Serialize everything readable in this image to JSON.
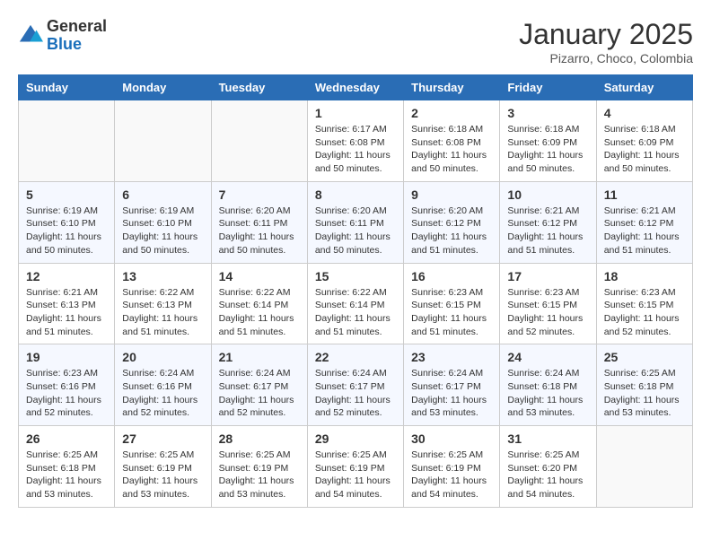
{
  "header": {
    "logo_general": "General",
    "logo_blue": "Blue",
    "month_title": "January 2025",
    "subtitle": "Pizarro, Choco, Colombia"
  },
  "days_of_week": [
    "Sunday",
    "Monday",
    "Tuesday",
    "Wednesday",
    "Thursday",
    "Friday",
    "Saturday"
  ],
  "weeks": [
    [
      {
        "day": "",
        "info": ""
      },
      {
        "day": "",
        "info": ""
      },
      {
        "day": "",
        "info": ""
      },
      {
        "day": "1",
        "info": "Sunrise: 6:17 AM\nSunset: 6:08 PM\nDaylight: 11 hours\nand 50 minutes."
      },
      {
        "day": "2",
        "info": "Sunrise: 6:18 AM\nSunset: 6:08 PM\nDaylight: 11 hours\nand 50 minutes."
      },
      {
        "day": "3",
        "info": "Sunrise: 6:18 AM\nSunset: 6:09 PM\nDaylight: 11 hours\nand 50 minutes."
      },
      {
        "day": "4",
        "info": "Sunrise: 6:18 AM\nSunset: 6:09 PM\nDaylight: 11 hours\nand 50 minutes."
      }
    ],
    [
      {
        "day": "5",
        "info": "Sunrise: 6:19 AM\nSunset: 6:10 PM\nDaylight: 11 hours\nand 50 minutes."
      },
      {
        "day": "6",
        "info": "Sunrise: 6:19 AM\nSunset: 6:10 PM\nDaylight: 11 hours\nand 50 minutes."
      },
      {
        "day": "7",
        "info": "Sunrise: 6:20 AM\nSunset: 6:11 PM\nDaylight: 11 hours\nand 50 minutes."
      },
      {
        "day": "8",
        "info": "Sunrise: 6:20 AM\nSunset: 6:11 PM\nDaylight: 11 hours\nand 50 minutes."
      },
      {
        "day": "9",
        "info": "Sunrise: 6:20 AM\nSunset: 6:12 PM\nDaylight: 11 hours\nand 51 minutes."
      },
      {
        "day": "10",
        "info": "Sunrise: 6:21 AM\nSunset: 6:12 PM\nDaylight: 11 hours\nand 51 minutes."
      },
      {
        "day": "11",
        "info": "Sunrise: 6:21 AM\nSunset: 6:12 PM\nDaylight: 11 hours\nand 51 minutes."
      }
    ],
    [
      {
        "day": "12",
        "info": "Sunrise: 6:21 AM\nSunset: 6:13 PM\nDaylight: 11 hours\nand 51 minutes."
      },
      {
        "day": "13",
        "info": "Sunrise: 6:22 AM\nSunset: 6:13 PM\nDaylight: 11 hours\nand 51 minutes."
      },
      {
        "day": "14",
        "info": "Sunrise: 6:22 AM\nSunset: 6:14 PM\nDaylight: 11 hours\nand 51 minutes."
      },
      {
        "day": "15",
        "info": "Sunrise: 6:22 AM\nSunset: 6:14 PM\nDaylight: 11 hours\nand 51 minutes."
      },
      {
        "day": "16",
        "info": "Sunrise: 6:23 AM\nSunset: 6:15 PM\nDaylight: 11 hours\nand 51 minutes."
      },
      {
        "day": "17",
        "info": "Sunrise: 6:23 AM\nSunset: 6:15 PM\nDaylight: 11 hours\nand 52 minutes."
      },
      {
        "day": "18",
        "info": "Sunrise: 6:23 AM\nSunset: 6:15 PM\nDaylight: 11 hours\nand 52 minutes."
      }
    ],
    [
      {
        "day": "19",
        "info": "Sunrise: 6:23 AM\nSunset: 6:16 PM\nDaylight: 11 hours\nand 52 minutes."
      },
      {
        "day": "20",
        "info": "Sunrise: 6:24 AM\nSunset: 6:16 PM\nDaylight: 11 hours\nand 52 minutes."
      },
      {
        "day": "21",
        "info": "Sunrise: 6:24 AM\nSunset: 6:17 PM\nDaylight: 11 hours\nand 52 minutes."
      },
      {
        "day": "22",
        "info": "Sunrise: 6:24 AM\nSunset: 6:17 PM\nDaylight: 11 hours\nand 52 minutes."
      },
      {
        "day": "23",
        "info": "Sunrise: 6:24 AM\nSunset: 6:17 PM\nDaylight: 11 hours\nand 53 minutes."
      },
      {
        "day": "24",
        "info": "Sunrise: 6:24 AM\nSunset: 6:18 PM\nDaylight: 11 hours\nand 53 minutes."
      },
      {
        "day": "25",
        "info": "Sunrise: 6:25 AM\nSunset: 6:18 PM\nDaylight: 11 hours\nand 53 minutes."
      }
    ],
    [
      {
        "day": "26",
        "info": "Sunrise: 6:25 AM\nSunset: 6:18 PM\nDaylight: 11 hours\nand 53 minutes."
      },
      {
        "day": "27",
        "info": "Sunrise: 6:25 AM\nSunset: 6:19 PM\nDaylight: 11 hours\nand 53 minutes."
      },
      {
        "day": "28",
        "info": "Sunrise: 6:25 AM\nSunset: 6:19 PM\nDaylight: 11 hours\nand 53 minutes."
      },
      {
        "day": "29",
        "info": "Sunrise: 6:25 AM\nSunset: 6:19 PM\nDaylight: 11 hours\nand 54 minutes."
      },
      {
        "day": "30",
        "info": "Sunrise: 6:25 AM\nSunset: 6:19 PM\nDaylight: 11 hours\nand 54 minutes."
      },
      {
        "day": "31",
        "info": "Sunrise: 6:25 AM\nSunset: 6:20 PM\nDaylight: 11 hours\nand 54 minutes."
      },
      {
        "day": "",
        "info": ""
      }
    ]
  ]
}
